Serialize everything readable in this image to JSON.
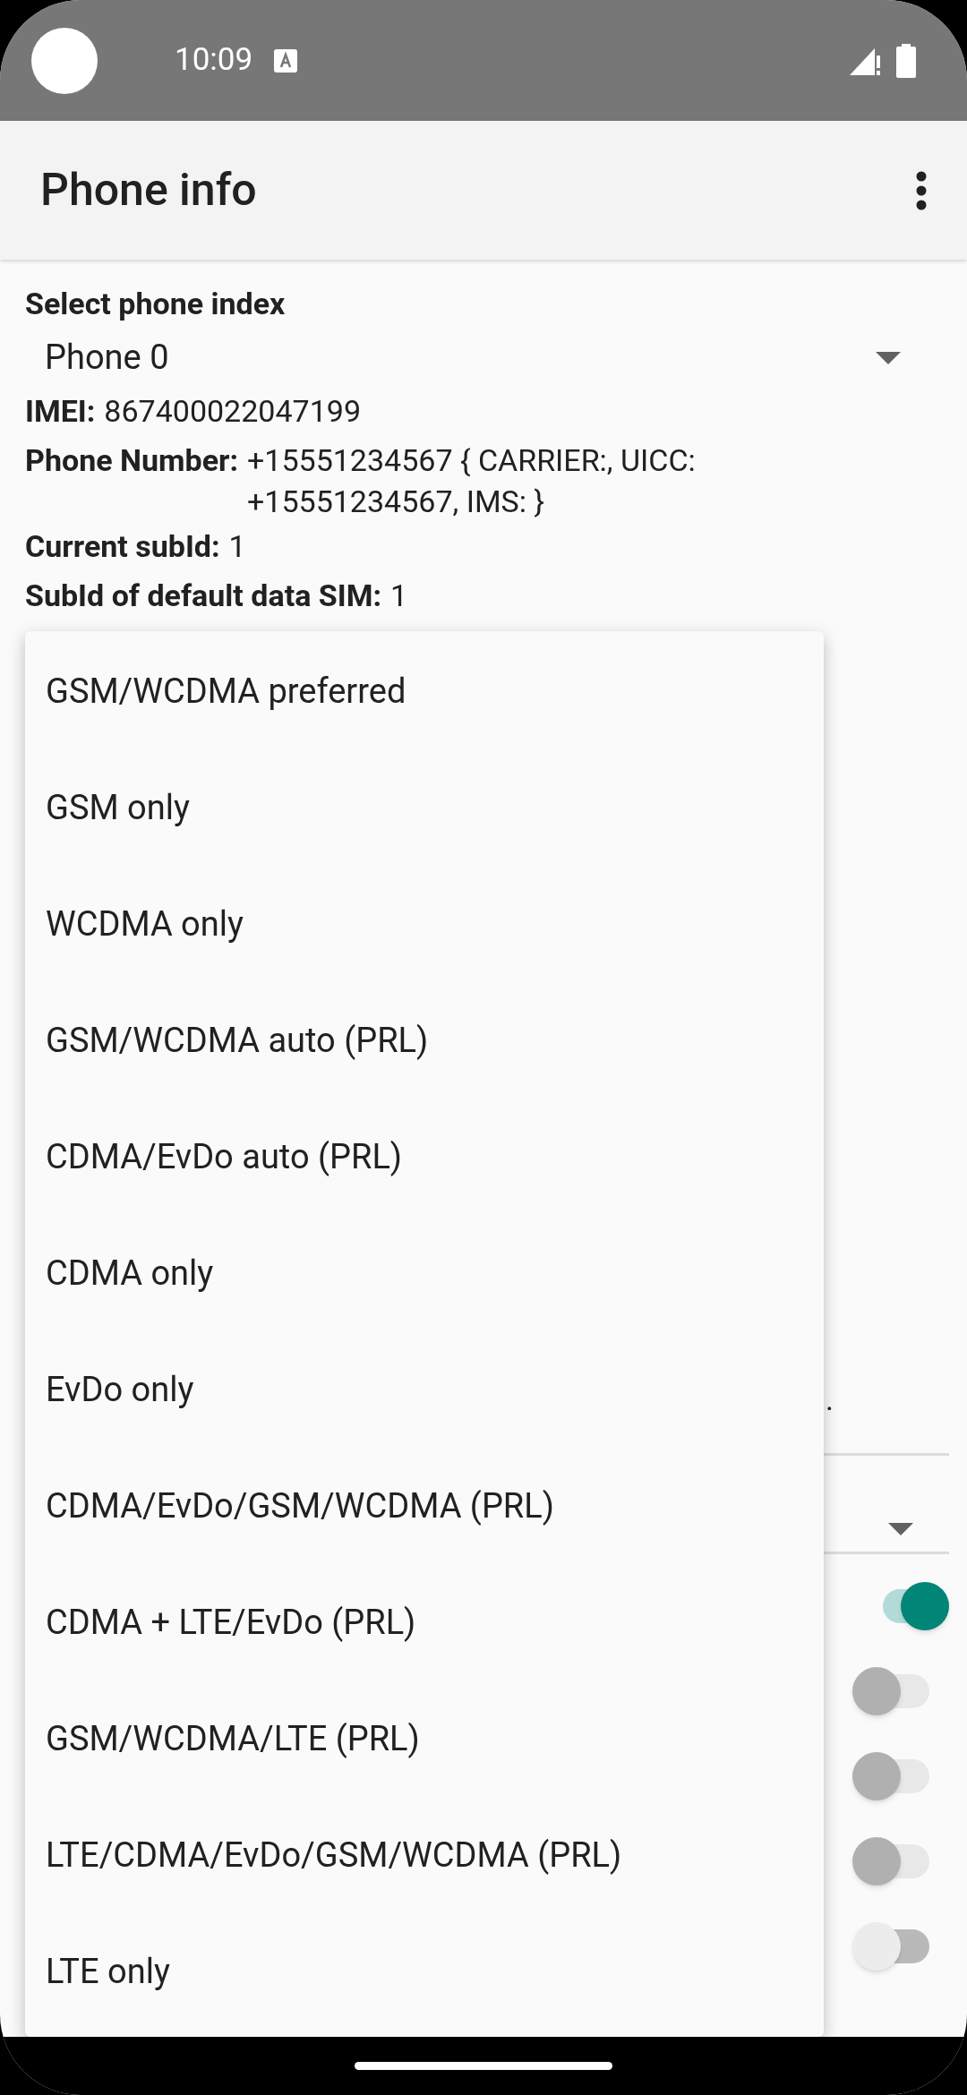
{
  "status_bar": {
    "time": "10:09"
  },
  "app_bar": {
    "title": "Phone info"
  },
  "phone_index": {
    "label": "Select phone index",
    "value": "Phone 0"
  },
  "info": [
    {
      "label": "IMEI:",
      "value": "867400022047199"
    },
    {
      "label": "Phone Number:",
      "value": "+15551234567 { CARRIER:, UICC: +15551234567, IMS: }"
    },
    {
      "label": "Current subId:",
      "value": "1"
    },
    {
      "label": "SubId of default data SIM:",
      "value": "1"
    }
  ],
  "text_tail": ".",
  "switches": [
    {
      "on": true,
      "disabled": false
    },
    {
      "on": false,
      "disabled": true
    },
    {
      "on": false,
      "disabled": true
    },
    {
      "on": false,
      "disabled": true
    },
    {
      "on": false,
      "disabled": false
    }
  ],
  "menu": {
    "items": [
      "GSM/WCDMA preferred",
      "GSM only",
      "WCDMA only",
      "GSM/WCDMA auto (PRL)",
      "CDMA/EvDo auto (PRL)",
      "CDMA only",
      "EvDo only",
      "CDMA/EvDo/GSM/WCDMA (PRL)",
      "CDMA + LTE/EvDo (PRL)",
      "GSM/WCDMA/LTE (PRL)",
      "LTE/CDMA/EvDo/GSM/WCDMA (PRL)",
      "LTE only"
    ]
  }
}
